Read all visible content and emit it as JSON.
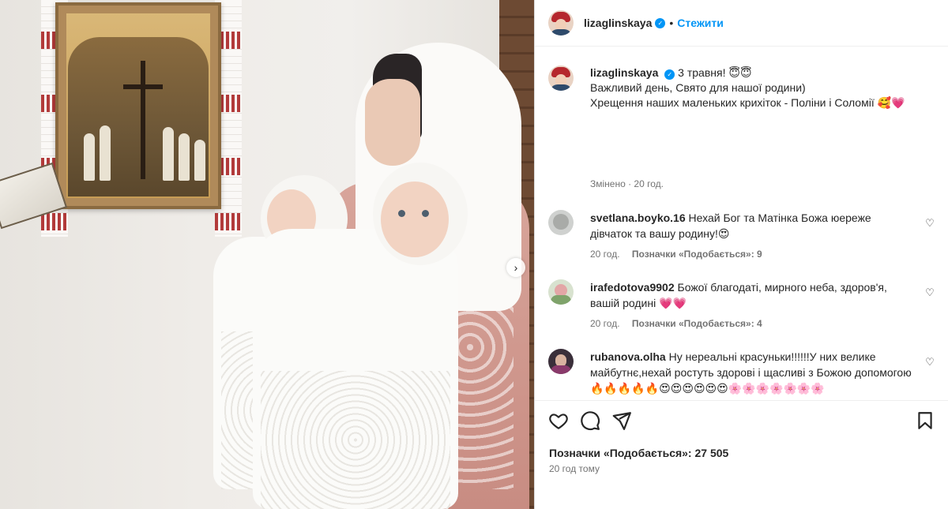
{
  "post": {
    "username": "lizaglinskaya",
    "follow_label": "Стежити",
    "separator": "•",
    "caption_lines": [
      "3 травня! 😇😇",
      "Важливий день, Свято для нашої родини)",
      "Хрещення наших маленьких крихіток - Поліни і Соломії 🥰💗"
    ],
    "edited": "Змінено · 20 год.",
    "likes_text": "Позначки «Подобається»: 27 505",
    "time_ago": "20 год тому"
  },
  "comments": [
    {
      "username": "svetlana.boyko.16",
      "text": "Нехай Бог та Матінка Божа юереже дівчаток та вашу родину!😍",
      "time": "20 год.",
      "likes": "Позначки «Подобається»: 9"
    },
    {
      "username": "irafedotova9902",
      "text": "Божої благодаті, мирного неба, здоров'я, вашій родині 💗💗",
      "time": "20 год.",
      "likes": "Позначки «Подобається»: 4"
    },
    {
      "username": "rubanova.olha",
      "text": "Ну нереальні красуньки!!!!!!У них велике майбутнє,нехай ростуть здорові і щасливі з Божою допомогою🔥🔥🔥🔥🔥😍😍😍😍😍😍🌸🌸🌸🌸🌸🌸🌸",
      "time": "",
      "likes": ""
    }
  ],
  "icons": {
    "like": "heart-icon",
    "comment": "comment-icon",
    "share": "paper-plane-icon",
    "save": "bookmark-icon",
    "carousel_next": "chevron-right-icon",
    "verified": "verified-badge-icon"
  },
  "colors": {
    "accent": "#0095f6",
    "text": "#262626",
    "muted": "#737373"
  }
}
